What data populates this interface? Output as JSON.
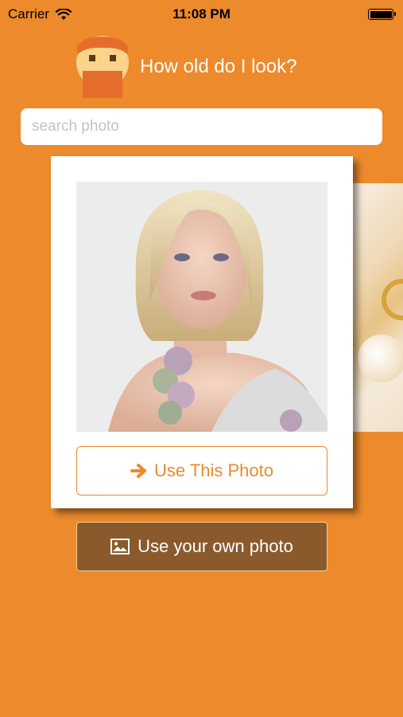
{
  "status_bar": {
    "carrier": "Carrier",
    "time": "11:08 PM",
    "battery_level": 1.0
  },
  "header": {
    "title": "How old do I look?",
    "logo_icon": "face-logo-icon"
  },
  "search": {
    "placeholder": "search photo",
    "value": ""
  },
  "photo_card": {
    "use_button_label": "Use This Photo",
    "use_button_icon": "arrow-right-icon"
  },
  "own_photo": {
    "label": "Use your own photo",
    "icon": "image-icon"
  },
  "colors": {
    "background": "#ec8a2c",
    "accent": "#ec8a2c",
    "own_photo_button": "#8a5a2c"
  }
}
